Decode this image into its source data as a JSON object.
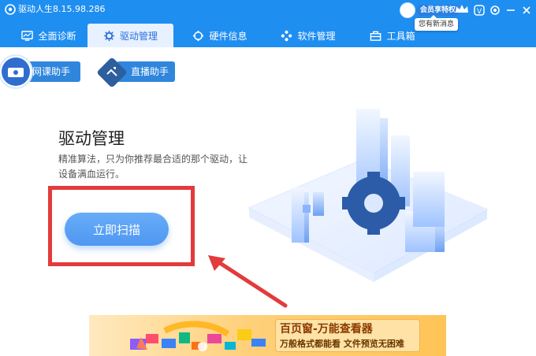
{
  "titlebar": {
    "app_title": "驱动人生8.15.98.286",
    "vip_label": "会员享特权",
    "message_bubble": "您有新消息",
    "icons": [
      "avatar",
      "crown-icon",
      "vip-badge-icon",
      "settings-icon",
      "minimize-icon",
      "close-icon"
    ]
  },
  "nav": {
    "tabs": [
      {
        "label": "全面诊断",
        "icon": "monitor-icon"
      },
      {
        "label": "驱动管理",
        "icon": "gear-icon",
        "active": true
      },
      {
        "label": "硬件信息",
        "icon": "hardware-icon"
      },
      {
        "label": "软件管理",
        "icon": "apps-icon"
      },
      {
        "label": "工具箱",
        "icon": "toolbox-icon"
      }
    ]
  },
  "helpers": [
    {
      "label": "网课助手",
      "icon": "online-class-icon"
    },
    {
      "label": "直播助手",
      "icon": "live-stream-icon"
    }
  ],
  "main": {
    "title": "驱动管理",
    "description": "精准算法，只为你推荐最合适的那个驱动，让设备满血运行。",
    "scan_button": "立即扫描"
  },
  "banner": {
    "title": "百页窗-万能查看器",
    "subtitle": "万般格式都能看  文件预览无困难"
  },
  "colors": {
    "header_blue": "#1f8ef1",
    "button_blue": "#5a9ff4",
    "highlight_red": "#e23b3b",
    "banner_orange": "#ffc457"
  }
}
